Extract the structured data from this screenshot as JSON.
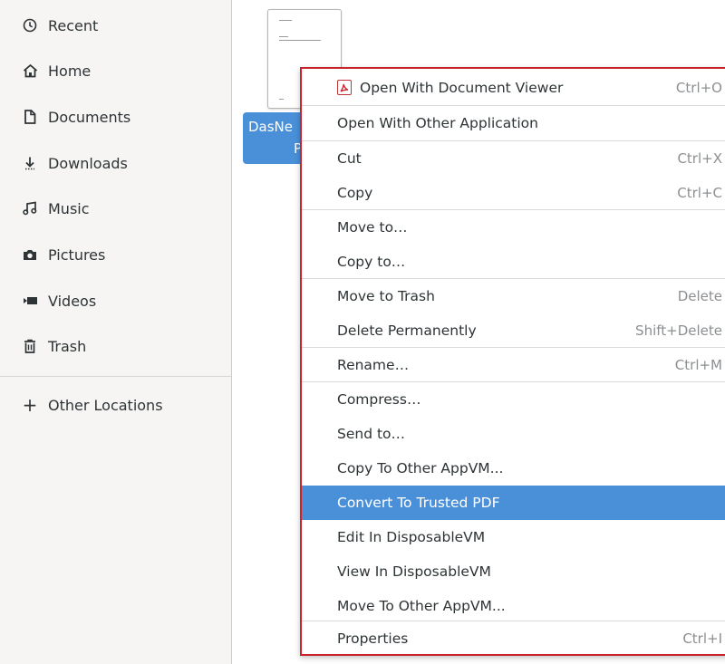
{
  "sidebar": {
    "items": [
      {
        "label": "Recent",
        "icon": "clock-icon"
      },
      {
        "label": "Home",
        "icon": "home-icon"
      },
      {
        "label": "Documents",
        "icon": "document-icon"
      },
      {
        "label": "Downloads",
        "icon": "download-icon"
      },
      {
        "label": "Music",
        "icon": "music-icon"
      },
      {
        "label": "Pictures",
        "icon": "camera-icon"
      },
      {
        "label": "Videos",
        "icon": "video-icon"
      },
      {
        "label": "Trash",
        "icon": "trash-icon"
      }
    ],
    "other_locations": {
      "label": "Other Locations",
      "icon": "plus-icon"
    }
  },
  "file": {
    "name_line1": "DasNe",
    "name_line2": "P",
    "icon": "pdf-document-thumbnail"
  },
  "context_menu": {
    "items": [
      {
        "label": "Open With Document Viewer",
        "accel": "Ctrl+O",
        "icon": "pdf-viewer-icon"
      },
      {
        "label": "Open With Other Application",
        "accel": ""
      },
      {
        "label": "Cut",
        "accel": "Ctrl+X"
      },
      {
        "label": "Copy",
        "accel": "Ctrl+C"
      },
      {
        "label": "Move to…",
        "accel": ""
      },
      {
        "label": "Copy to…",
        "accel": ""
      },
      {
        "label": "Move to Trash",
        "accel": "Delete"
      },
      {
        "label": "Delete Permanently",
        "accel": "Shift+Delete"
      },
      {
        "label": "Rename…",
        "accel": "Ctrl+M"
      },
      {
        "label": "Compress…",
        "accel": ""
      },
      {
        "label": "Send to…",
        "accel": ""
      },
      {
        "label": "Copy To Other AppVM...",
        "accel": ""
      },
      {
        "label": "Convert To Trusted PDF",
        "accel": "",
        "highlighted": true
      },
      {
        "label": "Edit In DisposableVM",
        "accel": ""
      },
      {
        "label": "View In DisposableVM",
        "accel": ""
      },
      {
        "label": "Move To Other AppVM...",
        "accel": ""
      },
      {
        "label": "Properties",
        "accel": "Ctrl+I"
      }
    ]
  },
  "colors": {
    "selection": "#4a90d9",
    "menu_border": "#c9242c",
    "sidebar_bg": "#f6f5f4"
  }
}
